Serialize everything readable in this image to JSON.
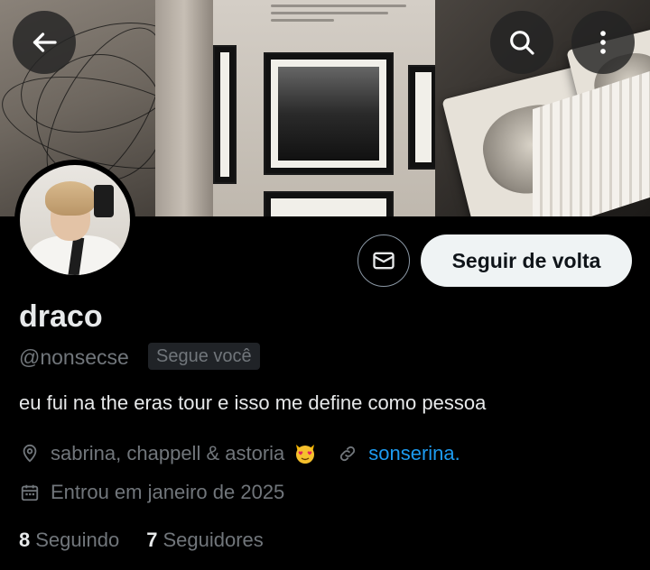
{
  "banner": {
    "back_icon": "arrow-left-icon",
    "search_icon": "search-icon",
    "more_icon": "more-vertical-icon"
  },
  "profile": {
    "display_name": "draco",
    "handle": "@nonsecse",
    "follows_you_badge": "Segue você",
    "bio": "eu fui na the eras tour e isso me define como pessoa",
    "location": "sabrina, chappell & astoria",
    "location_emoji": "heart-eyes-cat-emoji",
    "website": "sonserina.",
    "joined": "Entrou em janeiro de 2025"
  },
  "actions": {
    "message_icon": "envelope-icon",
    "follow_back_label": "Seguir de volta"
  },
  "stats": {
    "following_count": "8",
    "following_label": "Seguindo",
    "followers_count": "7",
    "followers_label": "Seguidores"
  },
  "colors": {
    "background": "#000000",
    "text_primary": "#e7e9ea",
    "text_secondary": "#71767b",
    "link": "#1d9bf0",
    "button_bg": "#eff3f4"
  }
}
